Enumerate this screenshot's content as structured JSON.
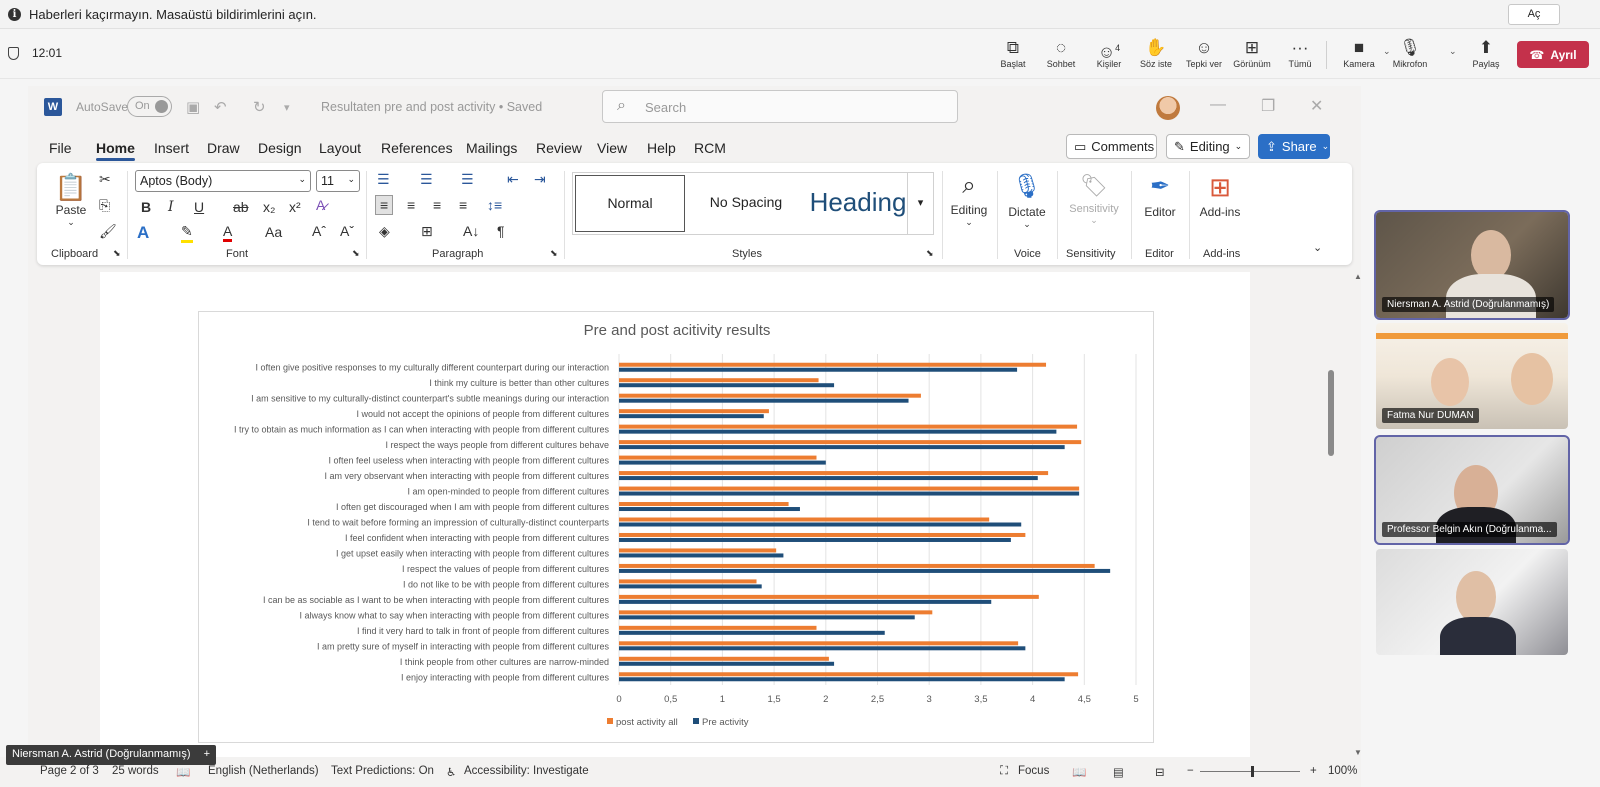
{
  "notification": {
    "message": "Haberleri kaçırmayın. Masaüstü bildirimlerini açın.",
    "open_label": "Aç"
  },
  "teams": {
    "time": "12:01",
    "buttons": [
      {
        "label": "Başlat",
        "icon": "share-screen-icon"
      },
      {
        "label": "Sohbet",
        "icon": "chat-icon"
      },
      {
        "label": "Kişiler",
        "icon": "people-icon",
        "count": "4"
      },
      {
        "label": "Söz iste",
        "icon": "raise-hand-icon"
      },
      {
        "label": "Tepki ver",
        "icon": "emoji-icon"
      },
      {
        "label": "Görünüm",
        "icon": "grid-icon"
      },
      {
        "label": "Tümü",
        "icon": "more-icon"
      },
      {
        "label": "Kamera",
        "icon": "camera-icon"
      },
      {
        "label": "Mikrofon",
        "icon": "mic-icon"
      },
      {
        "label": "Paylaş",
        "icon": "share-icon"
      }
    ],
    "leave_label": "Ayrıl"
  },
  "word": {
    "autosave_label": "AutoSave",
    "autosave_state": "On",
    "doc_title": "Resultaten pre and post activity • Saved",
    "search_placeholder": "Search",
    "menu": [
      "File",
      "Home",
      "Insert",
      "Draw",
      "Design",
      "Layout",
      "References",
      "Mailings",
      "Review",
      "View",
      "Help",
      "RCM"
    ],
    "comments_label": "Comments",
    "editing_label": "Editing",
    "share_label": "Share",
    "ribbon": {
      "clipboard": {
        "paste_label": "Paste",
        "group_label": "Clipboard"
      },
      "font": {
        "family": "Aptos (Body)",
        "size": "11",
        "group_label": "Font"
      },
      "paragraph": {
        "group_label": "Paragraph"
      },
      "styles": {
        "normal": "Normal",
        "no_spacing": "No Spacing",
        "heading": "Heading",
        "group_label": "Styles"
      },
      "editing_label": "Editing",
      "dictate_label": "Dictate",
      "voice_group": "Voice",
      "sensitivity_label": "Sensitivity",
      "sensitivity_group": "Sensitivity",
      "editor_label": "Editor",
      "editor_group": "Editor",
      "addins_label": "Add-ins",
      "addins_group": "Add-ins"
    },
    "status": {
      "page": "Page 2 of 3",
      "words": "25 words",
      "language": "English (Netherlands)",
      "text_predictions": "Text Predictions: On",
      "accessibility": "Accessibility: Investigate",
      "focus": "Focus",
      "zoom": "100%"
    }
  },
  "presenter_tag": "Niersman A. Astrid (Doğrulanmamış)",
  "participants": [
    {
      "name": "Niersman A. Astrid (Doğrulanmamış)"
    },
    {
      "name": "Fatma Nur DUMAN"
    },
    {
      "name": "Professor Belgin Akın (Doğrulanma..."
    },
    {
      "name": ""
    }
  ],
  "colors": {
    "post": "#ed7d31",
    "pre": "#1f4e79",
    "teams_leave": "#c4314b",
    "word_blue": "#2b579a"
  },
  "chart_data": {
    "type": "bar",
    "orientation": "horizontal",
    "title": "Pre and post acitivity results",
    "xlim": [
      0,
      5
    ],
    "xticks": [
      "0",
      "0,5",
      "1",
      "1,5",
      "2",
      "2,5",
      "3",
      "3,5",
      "4",
      "4,5",
      "5"
    ],
    "grid": true,
    "legend_position": "bottom",
    "categories": [
      "I often give positive responses to my culturally different counterpart during our interaction",
      "I think my culture is better than other cultures",
      "I am sensitive to my culturally-distinct counterpart's subtle meanings during our interaction",
      "I would not accept the opinions of people from different cultures",
      "I try to obtain as much information as I can when interacting with people from different cultures",
      "I respect the ways people from different cultures behave",
      "I often feel useless when interacting with people from different cultures",
      "I am very observant when interacting with people from different cultures",
      "I am open-minded to people from different cultures",
      "I often get discouraged when I am with people from different cultures",
      "I tend to wait before forming an impression of culturally-distinct counterparts",
      "I feel confident when interacting with people from different cultures",
      "I get upset easily when interacting with people from different cultures",
      "I respect the values of people from different cultures",
      "I do not like to be with people from different cultures",
      "I can be as sociable as I want to be when interacting with people from different cultures",
      "I always know what to say when interacting with people from different cultures",
      "I find it very hard to talk in front of people from different cultures",
      "I am pretty sure of myself in interacting with people from different cultures",
      "I think people from other cultures are narrow-minded",
      "I enjoy interacting with people from different cultures"
    ],
    "series": [
      {
        "name": "post activity all",
        "color": "#ed7d31",
        "values": [
          4.13,
          1.93,
          2.92,
          1.45,
          4.43,
          4.47,
          1.91,
          4.15,
          4.45,
          1.64,
          3.58,
          3.93,
          1.52,
          4.6,
          1.33,
          4.06,
          3.03,
          1.91,
          3.86,
          2.03,
          4.44
        ]
      },
      {
        "name": "Pre activity",
        "color": "#1f4e79",
        "values": [
          3.85,
          2.08,
          2.8,
          1.4,
          4.23,
          4.31,
          2.0,
          4.05,
          4.45,
          1.75,
          3.89,
          3.79,
          1.59,
          4.75,
          1.38,
          3.6,
          2.86,
          2.57,
          3.93,
          2.08,
          4.31
        ]
      }
    ]
  }
}
